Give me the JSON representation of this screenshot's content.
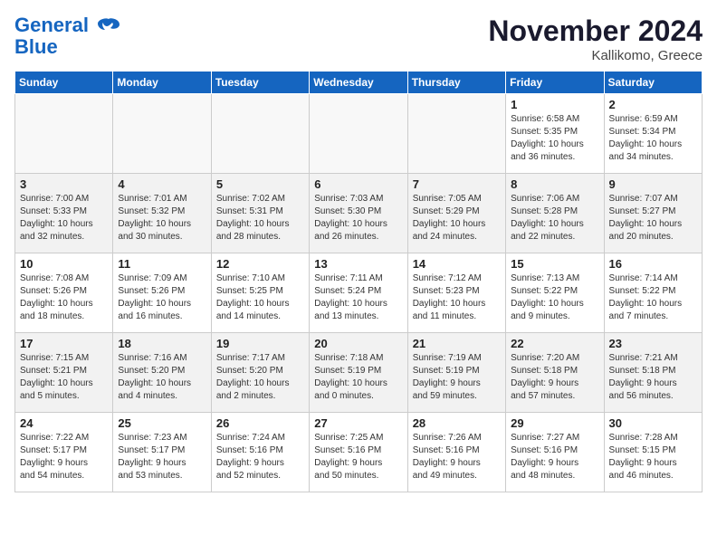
{
  "logo": {
    "line1": "General",
    "line2": "Blue"
  },
  "title": "November 2024",
  "location": "Kallikomo, Greece",
  "days_of_week": [
    "Sunday",
    "Monday",
    "Tuesday",
    "Wednesday",
    "Thursday",
    "Friday",
    "Saturday"
  ],
  "weeks": [
    [
      {
        "num": "",
        "info": ""
      },
      {
        "num": "",
        "info": ""
      },
      {
        "num": "",
        "info": ""
      },
      {
        "num": "",
        "info": ""
      },
      {
        "num": "",
        "info": ""
      },
      {
        "num": "1",
        "info": "Sunrise: 6:58 AM\nSunset: 5:35 PM\nDaylight: 10 hours\nand 36 minutes."
      },
      {
        "num": "2",
        "info": "Sunrise: 6:59 AM\nSunset: 5:34 PM\nDaylight: 10 hours\nand 34 minutes."
      }
    ],
    [
      {
        "num": "3",
        "info": "Sunrise: 7:00 AM\nSunset: 5:33 PM\nDaylight: 10 hours\nand 32 minutes."
      },
      {
        "num": "4",
        "info": "Sunrise: 7:01 AM\nSunset: 5:32 PM\nDaylight: 10 hours\nand 30 minutes."
      },
      {
        "num": "5",
        "info": "Sunrise: 7:02 AM\nSunset: 5:31 PM\nDaylight: 10 hours\nand 28 minutes."
      },
      {
        "num": "6",
        "info": "Sunrise: 7:03 AM\nSunset: 5:30 PM\nDaylight: 10 hours\nand 26 minutes."
      },
      {
        "num": "7",
        "info": "Sunrise: 7:05 AM\nSunset: 5:29 PM\nDaylight: 10 hours\nand 24 minutes."
      },
      {
        "num": "8",
        "info": "Sunrise: 7:06 AM\nSunset: 5:28 PM\nDaylight: 10 hours\nand 22 minutes."
      },
      {
        "num": "9",
        "info": "Sunrise: 7:07 AM\nSunset: 5:27 PM\nDaylight: 10 hours\nand 20 minutes."
      }
    ],
    [
      {
        "num": "10",
        "info": "Sunrise: 7:08 AM\nSunset: 5:26 PM\nDaylight: 10 hours\nand 18 minutes."
      },
      {
        "num": "11",
        "info": "Sunrise: 7:09 AM\nSunset: 5:26 PM\nDaylight: 10 hours\nand 16 minutes."
      },
      {
        "num": "12",
        "info": "Sunrise: 7:10 AM\nSunset: 5:25 PM\nDaylight: 10 hours\nand 14 minutes."
      },
      {
        "num": "13",
        "info": "Sunrise: 7:11 AM\nSunset: 5:24 PM\nDaylight: 10 hours\nand 13 minutes."
      },
      {
        "num": "14",
        "info": "Sunrise: 7:12 AM\nSunset: 5:23 PM\nDaylight: 10 hours\nand 11 minutes."
      },
      {
        "num": "15",
        "info": "Sunrise: 7:13 AM\nSunset: 5:22 PM\nDaylight: 10 hours\nand 9 minutes."
      },
      {
        "num": "16",
        "info": "Sunrise: 7:14 AM\nSunset: 5:22 PM\nDaylight: 10 hours\nand 7 minutes."
      }
    ],
    [
      {
        "num": "17",
        "info": "Sunrise: 7:15 AM\nSunset: 5:21 PM\nDaylight: 10 hours\nand 5 minutes."
      },
      {
        "num": "18",
        "info": "Sunrise: 7:16 AM\nSunset: 5:20 PM\nDaylight: 10 hours\nand 4 minutes."
      },
      {
        "num": "19",
        "info": "Sunrise: 7:17 AM\nSunset: 5:20 PM\nDaylight: 10 hours\nand 2 minutes."
      },
      {
        "num": "20",
        "info": "Sunrise: 7:18 AM\nSunset: 5:19 PM\nDaylight: 10 hours\nand 0 minutes."
      },
      {
        "num": "21",
        "info": "Sunrise: 7:19 AM\nSunset: 5:19 PM\nDaylight: 9 hours\nand 59 minutes."
      },
      {
        "num": "22",
        "info": "Sunrise: 7:20 AM\nSunset: 5:18 PM\nDaylight: 9 hours\nand 57 minutes."
      },
      {
        "num": "23",
        "info": "Sunrise: 7:21 AM\nSunset: 5:18 PM\nDaylight: 9 hours\nand 56 minutes."
      }
    ],
    [
      {
        "num": "24",
        "info": "Sunrise: 7:22 AM\nSunset: 5:17 PM\nDaylight: 9 hours\nand 54 minutes."
      },
      {
        "num": "25",
        "info": "Sunrise: 7:23 AM\nSunset: 5:17 PM\nDaylight: 9 hours\nand 53 minutes."
      },
      {
        "num": "26",
        "info": "Sunrise: 7:24 AM\nSunset: 5:16 PM\nDaylight: 9 hours\nand 52 minutes."
      },
      {
        "num": "27",
        "info": "Sunrise: 7:25 AM\nSunset: 5:16 PM\nDaylight: 9 hours\nand 50 minutes."
      },
      {
        "num": "28",
        "info": "Sunrise: 7:26 AM\nSunset: 5:16 PM\nDaylight: 9 hours\nand 49 minutes."
      },
      {
        "num": "29",
        "info": "Sunrise: 7:27 AM\nSunset: 5:16 PM\nDaylight: 9 hours\nand 48 minutes."
      },
      {
        "num": "30",
        "info": "Sunrise: 7:28 AM\nSunset: 5:15 PM\nDaylight: 9 hours\nand 46 minutes."
      }
    ]
  ]
}
